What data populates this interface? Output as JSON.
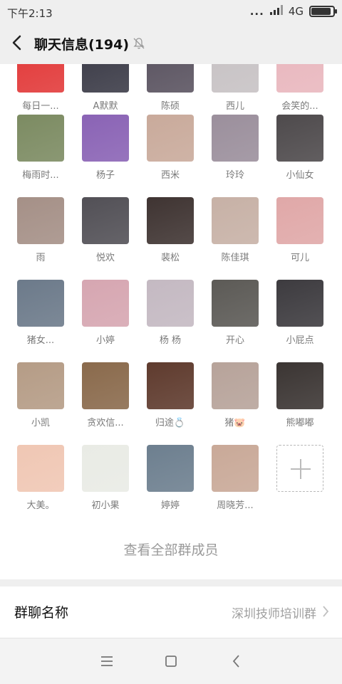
{
  "status_bar": {
    "time": "下午2:13",
    "dots": "...",
    "network": "4G",
    "battery_level": 0.9
  },
  "header": {
    "title": "聊天信息(194)",
    "back_icon": "back-arrow-icon",
    "mute_icon": "bell-mute-icon"
  },
  "members": [
    {
      "name": "每日一...",
      "color": "#e23a3a"
    },
    {
      "name": "A默默",
      "color": "#3b3b47"
    },
    {
      "name": "陈硕",
      "color": "#5a5360"
    },
    {
      "name": "西儿",
      "color": "#c7c2c4"
    },
    {
      "name": "会笑的...",
      "color": "#e9b7be"
    },
    {
      "name": "梅雨时...",
      "color": "#7c8b62"
    },
    {
      "name": "杨子",
      "color": "#8a63b5"
    },
    {
      "name": "西米",
      "color": "#c9aa9b"
    },
    {
      "name": "玲玲",
      "color": "#9b8f9c"
    },
    {
      "name": "小仙女",
      "color": "#4e4a4c"
    },
    {
      "name": "雨",
      "color": "#a59087"
    },
    {
      "name": "悦欢",
      "color": "#525056"
    },
    {
      "name": "裴松",
      "color": "#3f3432"
    },
    {
      "name": "陈佳琪",
      "color": "#c7b1a6"
    },
    {
      "name": "可儿",
      "color": "#e0a8a8"
    },
    {
      "name": "猪女...",
      "color": "#6c7a8a"
    },
    {
      "name": "小婷",
      "color": "#d6a6b1"
    },
    {
      "name": "杨 杨",
      "color": "#c4b9c2"
    },
    {
      "name": "开心",
      "color": "#5c5a56"
    },
    {
      "name": "小屁点",
      "color": "#3d3b3f"
    },
    {
      "name": "小凯",
      "color": "#b59c86"
    },
    {
      "name": "贪欢信...",
      "color": "#8a6a4c"
    },
    {
      "name": "归途💍",
      "color": "#5f3b2e"
    },
    {
      "name": "猪🐷",
      "color": "#b7a39a"
    },
    {
      "name": "熊嘟嘟",
      "color": "#3b3533"
    },
    {
      "name": "大美。",
      "color": "#f0c7b4"
    },
    {
      "name": "初小果",
      "color": "#e9ebe5"
    },
    {
      "name": "婷婷",
      "color": "#6d7f8f"
    },
    {
      "name": "周晓芳...",
      "color": "#c9a998"
    }
  ],
  "add_tile_icon": "plus-icon",
  "view_all_label": "查看全部群成员",
  "group_name_row": {
    "label": "群聊名称",
    "value": "深圳技师培训群",
    "arrow_icon": "chevron-right-icon"
  },
  "nav_bar": {
    "menu_icon": "menu-icon",
    "home_icon": "home-icon",
    "back_icon": "back-icon"
  }
}
